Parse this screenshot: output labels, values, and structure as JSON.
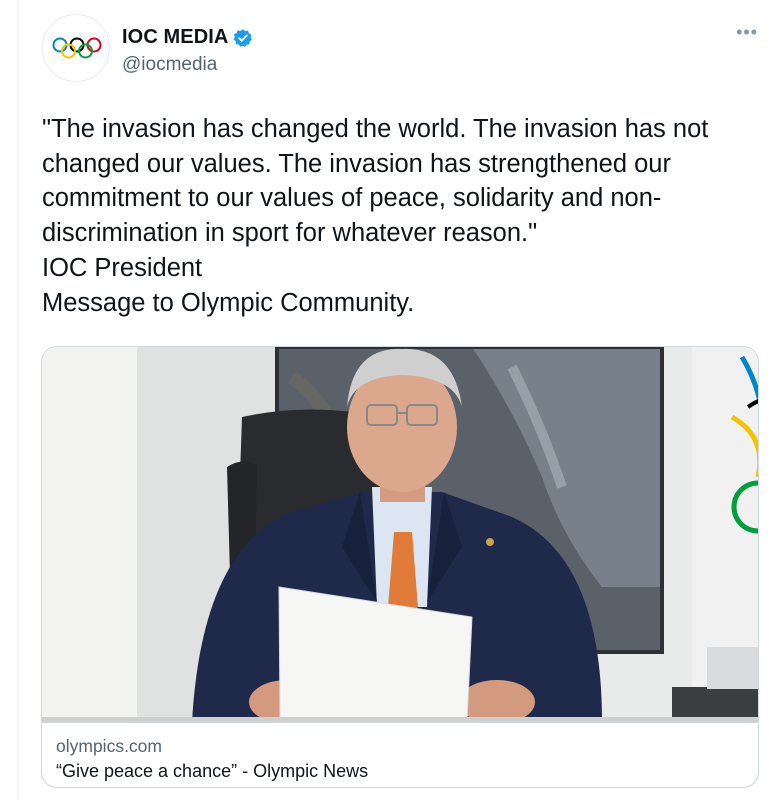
{
  "tweet": {
    "author_name": "IOC MEDIA",
    "author_handle": "@iocmedia",
    "more_label": "•••",
    "text": "\"The invasion has changed the world. The invasion has not\nchanged our values. The invasion has strengthened our\ncommitment to our values of peace, solidarity and non-\ndiscrimination in sport for whatever reason.\"\nIOC President\nMessage to Olympic Community."
  },
  "card": {
    "domain": "olympics.com",
    "title": "“Give peace a chance” - Olympic News"
  },
  "colors": {
    "verified": "#1d9bf0",
    "ring_blue": "#0085c7",
    "ring_yellow": "#f4c300",
    "ring_black": "#000000",
    "ring_green": "#009f3d",
    "ring_red": "#df0024"
  },
  "icons": [
    "olympic-rings-logo",
    "verified-badge-icon",
    "more-options-icon"
  ]
}
